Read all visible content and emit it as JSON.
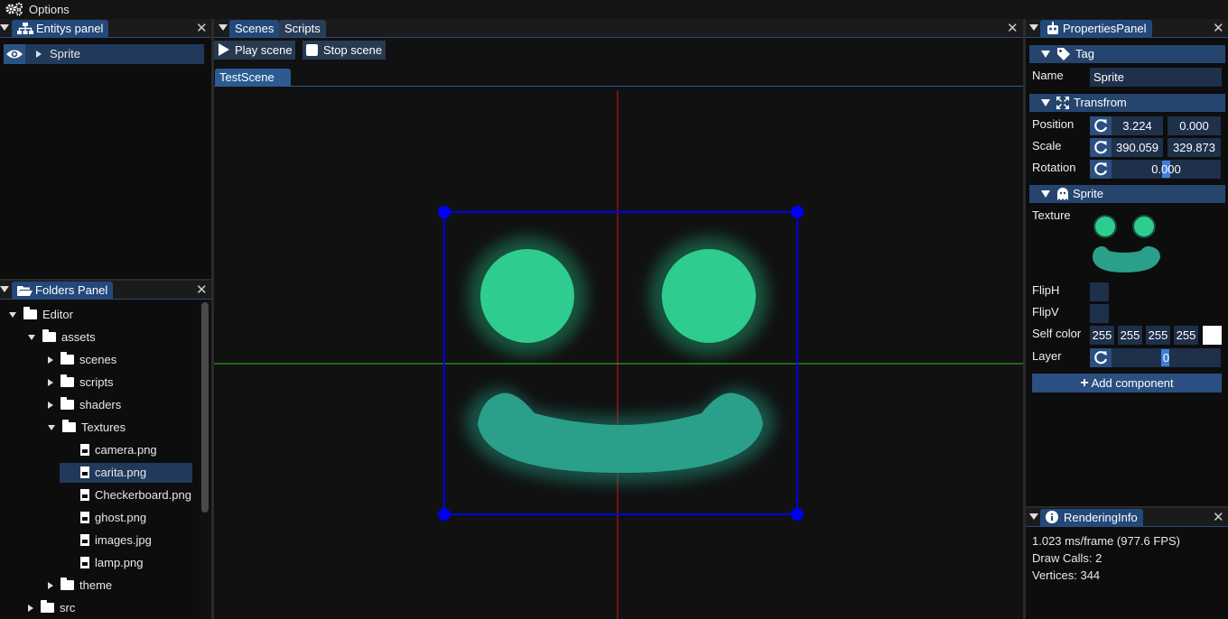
{
  "menubar": {
    "title": "Options",
    "icon": "gear-icon"
  },
  "entities_panel": {
    "title": "Entitys panel",
    "items": [
      {
        "label": "Sprite"
      }
    ]
  },
  "folders_panel": {
    "title": "Folders Panel",
    "tree": [
      {
        "label": "Editor",
        "type": "folder",
        "expanded": true
      },
      {
        "label": "assets",
        "type": "folder",
        "expanded": true
      },
      {
        "label": "scenes",
        "type": "folder",
        "expanded": false
      },
      {
        "label": "scripts",
        "type": "folder",
        "expanded": false
      },
      {
        "label": "shaders",
        "type": "folder",
        "expanded": false
      },
      {
        "label": "Textures",
        "type": "folder",
        "expanded": true
      },
      {
        "label": "camera.png",
        "type": "file"
      },
      {
        "label": "carita.png",
        "type": "file",
        "selected": true
      },
      {
        "label": "Checkerboard.png",
        "type": "file"
      },
      {
        "label": "ghost.png",
        "type": "file"
      },
      {
        "label": "images.jpg",
        "type": "file"
      },
      {
        "label": "lamp.png",
        "type": "file"
      },
      {
        "label": "theme",
        "type": "folder",
        "expanded": false
      },
      {
        "label": "src",
        "type": "folder",
        "expanded": false
      }
    ]
  },
  "scene_panel": {
    "tabs": [
      {
        "label": "Scenes"
      },
      {
        "label": "Scripts"
      }
    ],
    "play_label": "Play scene",
    "stop_label": "Stop scene",
    "scene_tab": "TestScene"
  },
  "properties_panel": {
    "title": "PropertiesPanel",
    "tag": {
      "section": "Tag",
      "name_label": "Name",
      "name_value": "Sprite"
    },
    "transform": {
      "section": "Transfrom",
      "position_label": "Position",
      "position": [
        "3.224",
        "0.000"
      ],
      "scale_label": "Scale",
      "scale": [
        "390.059",
        "329.873"
      ],
      "rotation_label": "Rotation",
      "rotation": "0.000"
    },
    "sprite": {
      "section": "Sprite",
      "texture_label": "Texture",
      "fliph_label": "FlipH",
      "flipv_label": "FlipV",
      "color_label": "Self color",
      "color": [
        "255",
        "255",
        "255",
        "255"
      ],
      "layer_label": "Layer",
      "layer": "0"
    },
    "add_component": "Add component"
  },
  "rendering_info": {
    "title": "RenderingInfo",
    "lines": [
      "1.023 ms/frame (977.6 FPS)",
      "Draw Calls: 2",
      "Vertices: 344"
    ]
  },
  "colors": {
    "accent": "#25456f",
    "gizmo": "#0000ff",
    "sprite_teal": "#2ecc8e"
  }
}
